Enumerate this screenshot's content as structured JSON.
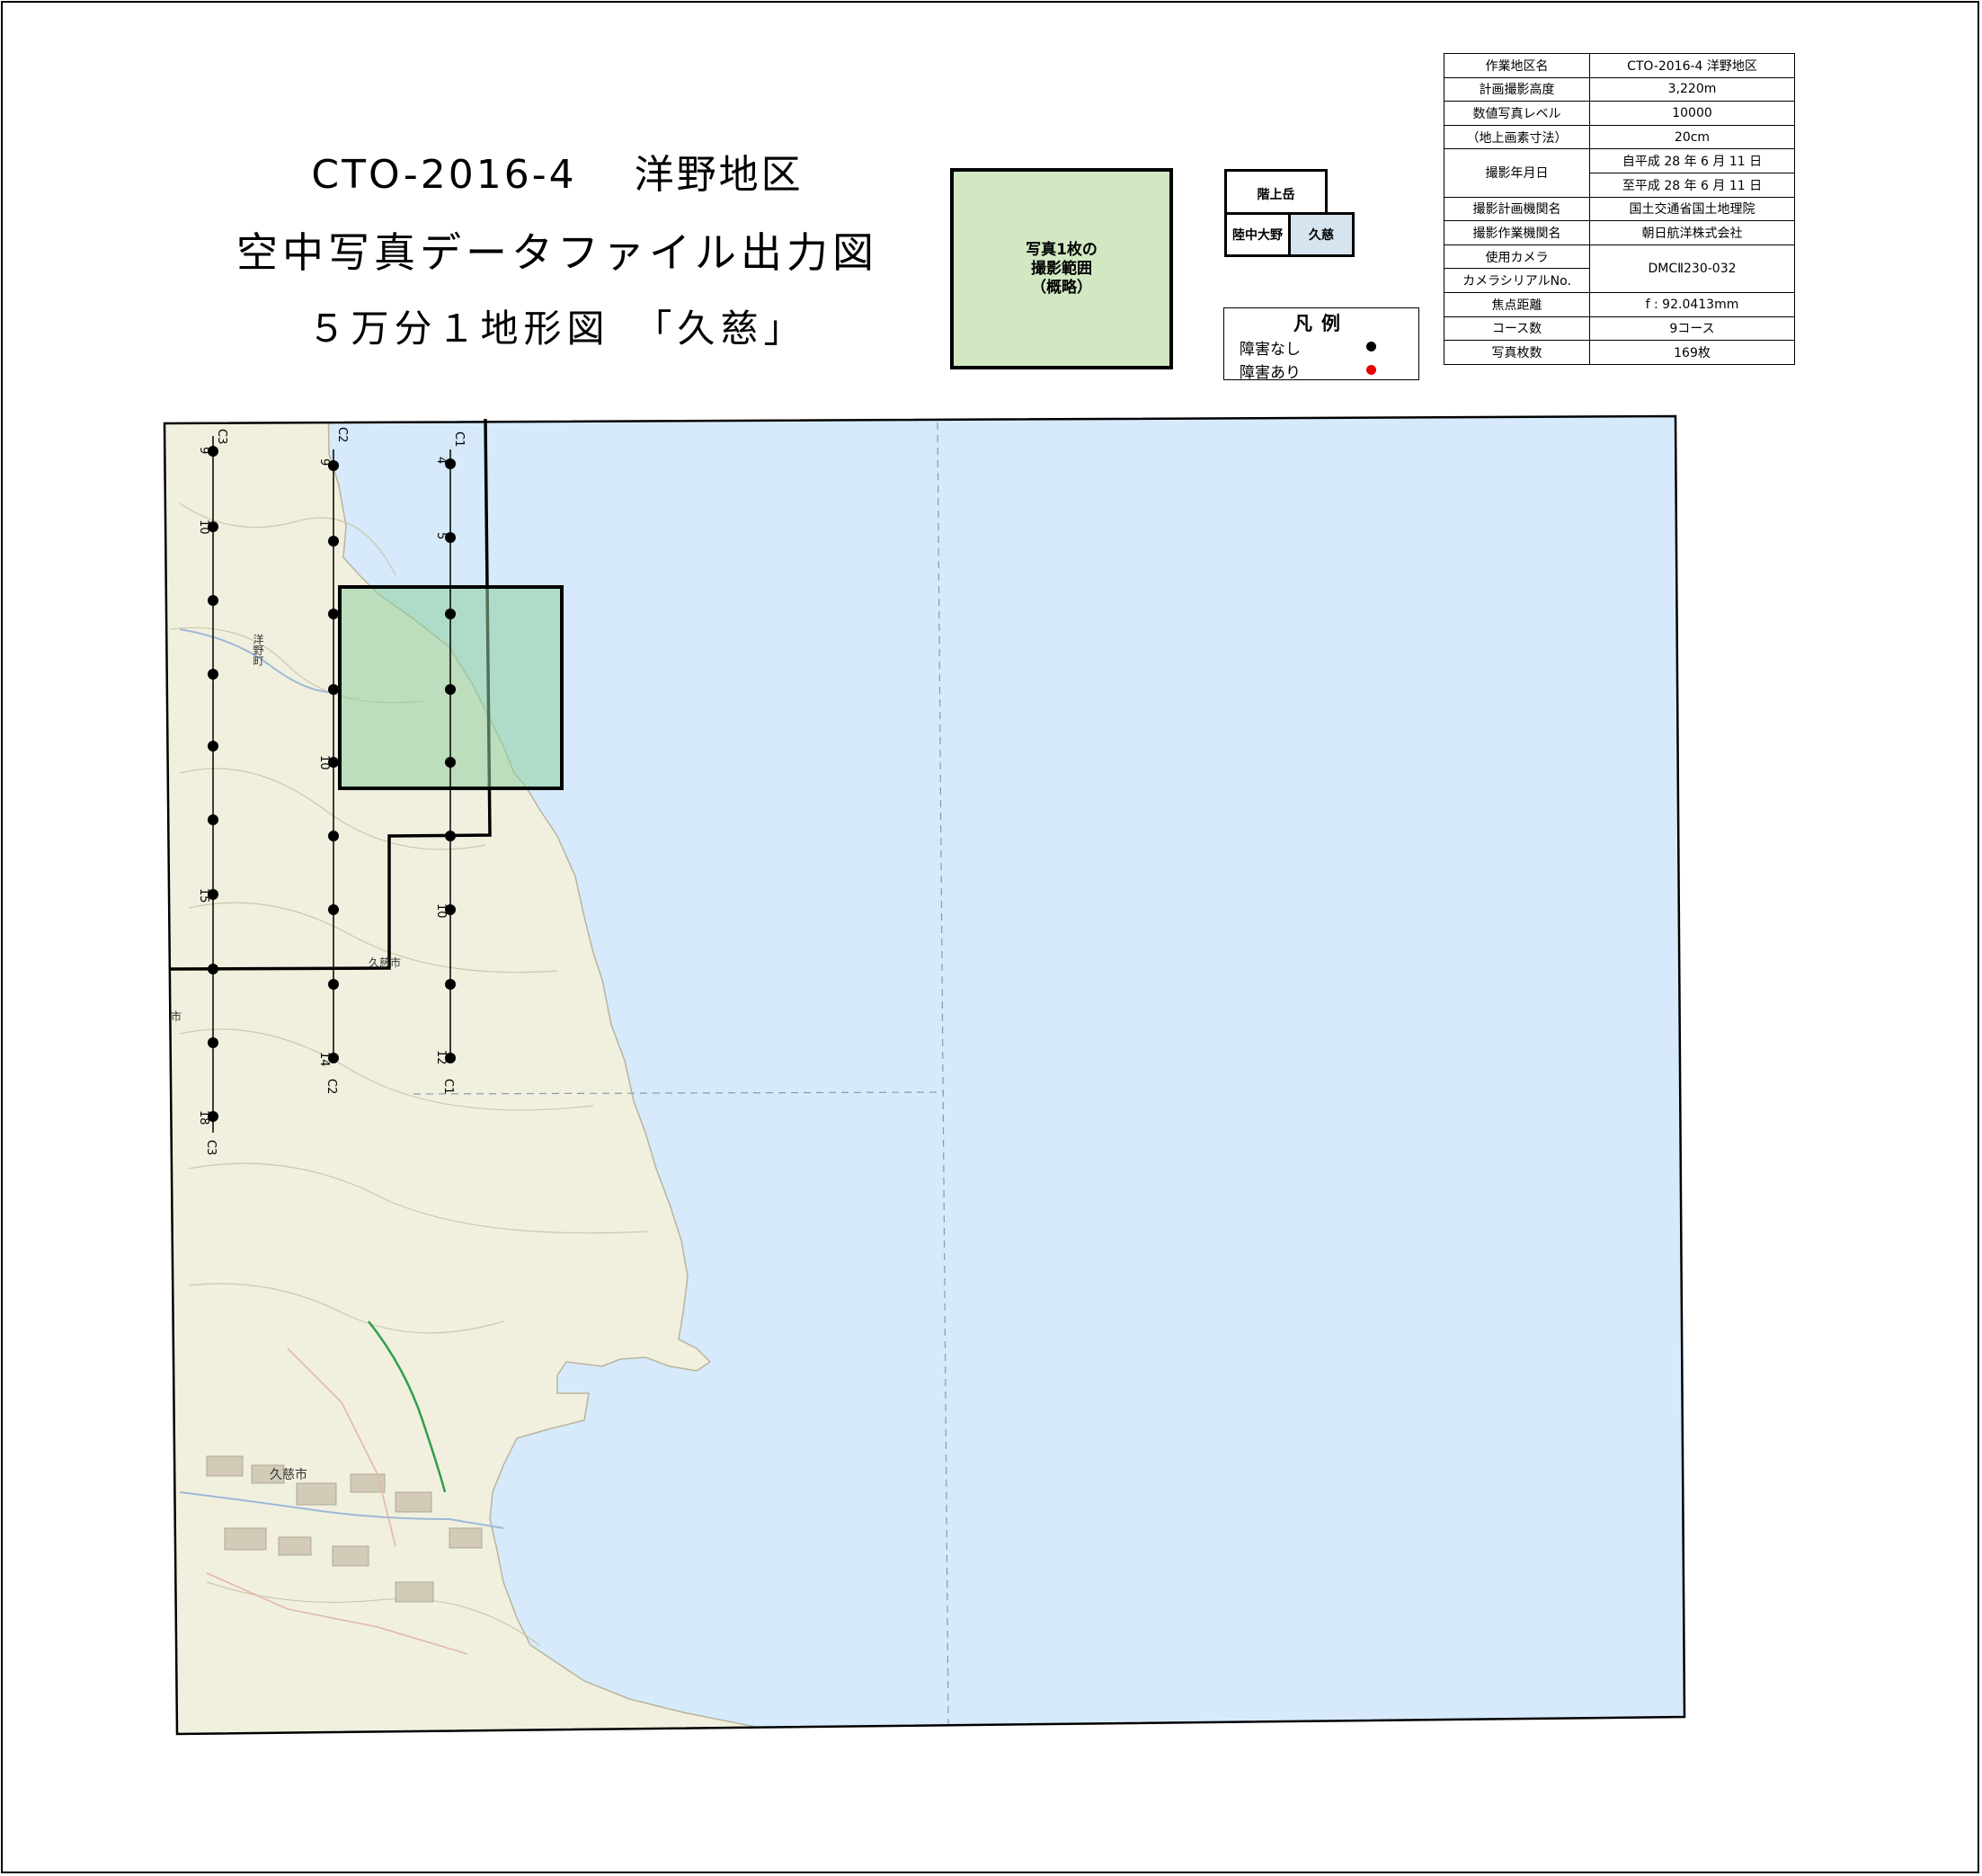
{
  "title": {
    "line1": "CTO-2016-4　 洋野地区",
    "line2": "空中写真データファイル出力図",
    "line3": "５万分１地形図　「久慈」"
  },
  "photo_footprint_label": [
    "写真1枚の",
    "撮影範囲",
    "（概略）"
  ],
  "index_map": {
    "cells": [
      "階上岳",
      "陸中大野",
      "久慈"
    ],
    "current": "久慈"
  },
  "legend": {
    "title": "凡例",
    "items": [
      {
        "label": "障害なし",
        "color": "#000000"
      },
      {
        "label": "障害あり",
        "color": "#e60000"
      }
    ]
  },
  "info_table": [
    {
      "key": "作業地区名",
      "value": "CTO-2016-4 洋野地区"
    },
    {
      "key": "計画撮影高度",
      "value": "3,220m"
    },
    {
      "key": "数値写真レベル",
      "value": "10000"
    },
    {
      "key": "（地上画素寸法）",
      "value": "20cm"
    },
    {
      "key": "撮影年月日",
      "value": "自平成 28 年 6 月 11 日",
      "value2": "至平成 28 年 6 月 11 日"
    },
    {
      "key": "撮影計画機関名",
      "value": "国土交通省国土地理院"
    },
    {
      "key": "撮影作業機関名",
      "value": "朝日航洋株式会社"
    },
    {
      "key": "使用カメラ",
      "key2": "カメラシリアルNo.",
      "value": "DMCⅡ230-032"
    },
    {
      "key": "焦点距離",
      "value": "f : 92.0413mm"
    },
    {
      "key": "コース数",
      "value": "9コース"
    },
    {
      "key": "写真枚数",
      "value": "169枚"
    }
  ],
  "map": {
    "colors": {
      "sea": "#d6eafb",
      "land": "#f1f0df",
      "footprint": "#8fcf9f",
      "point_ok": "#000000"
    },
    "place_labels": [
      "洋野町",
      "久慈市",
      "久慈市",
      "市"
    ],
    "courses": [
      {
        "name": "C1",
        "photo_numbers": [
          4,
          5,
          10,
          12
        ]
      },
      {
        "name": "C2",
        "photo_numbers": [
          9,
          10,
          14
        ]
      },
      {
        "name": "C3",
        "photo_numbers": [
          9,
          10,
          15,
          18
        ]
      }
    ]
  }
}
